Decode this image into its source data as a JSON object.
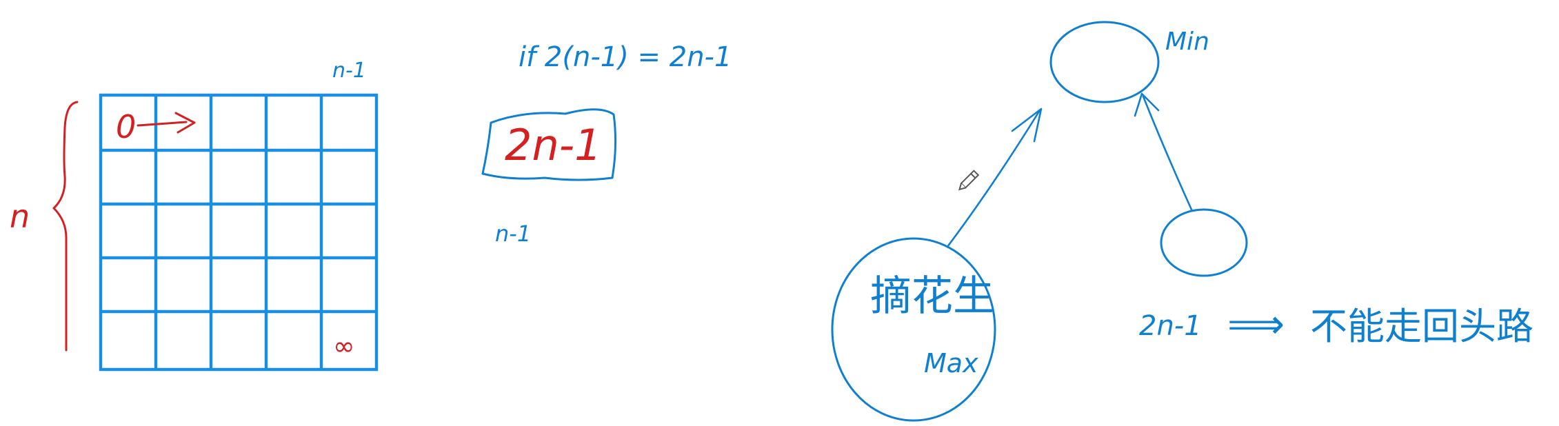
{
  "colors": {
    "blue_ink": "#0F7FD0",
    "grid_blue": "#1A8FE0",
    "red_ink": "#D42020",
    "background": "#ffffff"
  },
  "grid": {
    "rows": 5,
    "cols": 5,
    "top_right_label": "n-1",
    "start_cell_label": "0",
    "end_cell_label": "∞"
  },
  "brace_label": "n",
  "condition_text": "if 2(n-1) = 2n-1",
  "boxed_text": "2n-1",
  "below_box_text": "n-1",
  "nodes": {
    "top_label": "Min",
    "big_text": "摘花生",
    "big_sub": "Max"
  },
  "conclusion": {
    "prefix": "2n-1",
    "arrow": "⟹",
    "text": "不能走回头路"
  },
  "icons": {
    "cursor": "pencil-icon"
  }
}
